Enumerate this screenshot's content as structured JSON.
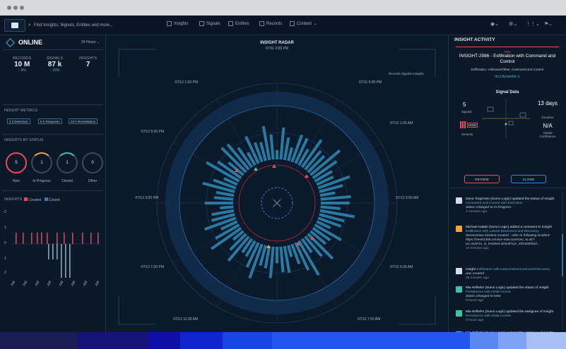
{
  "nav": {
    "search_placeholder": "Find Insights, Signals, Entities and more...",
    "items": [
      {
        "label": "Insights"
      },
      {
        "label": "Signals"
      },
      {
        "label": "Entities"
      },
      {
        "label": "Records"
      },
      {
        "label": "Content"
      }
    ]
  },
  "status": {
    "label": "ONLINE",
    "range": "24 Hours"
  },
  "stats": [
    {
      "label": "RECORDS",
      "value": "10 M",
      "delta": "↑ 9%"
    },
    {
      "label": "SIGNALS",
      "value": "87 k",
      "delta": "↑ 16%"
    },
    {
      "label": "INSIGHTS",
      "value": "7",
      "delta": ""
    }
  ],
  "metrics": {
    "title": "INSIGHT METRICS",
    "badges": [
      "4 d  Detection",
      "5 h  Response",
      "23 h  Remediation"
    ]
  },
  "by_status": {
    "title": "INSIGHTS BY STATUS",
    "items": [
      {
        "label": "New",
        "value": "5",
        "color": "#e84c5d"
      },
      {
        "label": "In Progress",
        "value": "1",
        "color": "#f0a23b"
      },
      {
        "label": "Closed",
        "value": "1",
        "color": "#38c7a0"
      },
      {
        "label": "Other",
        "value": "0",
        "color": "#3c4a58"
      }
    ]
  },
  "insights_chart": {
    "title": "INSIGHTS",
    "legend": [
      "Created",
      "Closed"
    ],
    "yticks": [
      "2",
      "1",
      "0",
      "1",
      "2"
    ],
    "xticks": [
      "PM",
      "PM",
      "AM",
      "AM",
      "AM",
      "AM",
      "AM",
      "AM"
    ]
  },
  "radar": {
    "title": "INSIGHT RADAR",
    "legend": [
      "Records",
      "Signals",
      "Insights"
    ],
    "times": [
      "07/11 3:00 PM",
      "07/11 9:00 PM",
      "07/12 1:00 AM",
      "07/12 3:00 AM",
      "07/12 5:00 AM",
      "07/12 7:00 AM",
      "07/12 9:00 AM",
      "07/12 11:00 AM",
      "07/12 1:00 PM",
      "07/12 3:00 PM",
      "07/12 5:00 PM",
      "07/12 1:00 PM"
    ],
    "time_top": "07/11 3:00 PM",
    "time_bottom": "07/12 7:00 AM"
  },
  "activity": {
    "title": "INSIGHT ACTIVITY",
    "card": {
      "tag": "New",
      "id": "INSIGHT-2986 - Exfiltration with Command and Control",
      "tactics": "Exfiltration, Unknown/Other, Command and Control",
      "entity": "ricci.dynamite"
    },
    "signal_data": {
      "title": "Signal Data",
      "signals": "5",
      "signals_label": "Signals",
      "duration": "13 days",
      "duration_label": "Duration",
      "severity": "HIGH",
      "severity_label": "Severity",
      "confidence": "N/A",
      "confidence_label": "Global Confidence"
    },
    "review": "REVIEW",
    "close": "CLOSE",
    "feed": [
      {
        "color": "#d4dde6",
        "name": "Dana Torgersen (Sumo Logic)",
        "text": "updated the status of Insight",
        "link": "Command and Control with Execution",
        "status": "Status changed to In Progress",
        "time": "4 minutes ago"
      },
      {
        "color": "#f0a23b",
        "name": "Michael Halabi (Sumo Logic)",
        "text": "added a comment to Insight",
        "link": "Exfiltration with Lateral Movement and Discovery",
        "status": "ServiceNow incident created - refer to following incident: https://ven01356.service-now.com/nav_to.do?uri=%2Fsn_si_incident.do%3Fsys_id%3D9f452...",
        "time": "15 minutes ago"
      },
      {
        "color": "#d4dde6",
        "name": "Insight",
        "text": "",
        "link": "Exfiltration with Lateral Movement and Discovery",
        "status": "was created",
        "time": "28 minutes ago"
      },
      {
        "color": "#38c7a0",
        "name": "Mia Wilhelm (Sumo Logic)",
        "text": "updated the status of Insight",
        "link": "Persistence with Initial Access",
        "status": "Status changed to New",
        "time": "5 hours ago"
      },
      {
        "color": "#38c7a0",
        "name": "Mia Wilhelm (Sumo Logic)",
        "text": "updated the assignee of Insight",
        "link": "Persistence with Initial Access",
        "status": "",
        "time": "5 hours ago"
      },
      {
        "color": "#38c7a0",
        "name": "Mia Wilhelm (Sumo Logic)",
        "text": "updated the assignee of Insight",
        "link": "Persistence with Initial Access",
        "status": "Assignee changed to user Mia Wilhelm (Sumo",
        "time": ""
      }
    ]
  }
}
